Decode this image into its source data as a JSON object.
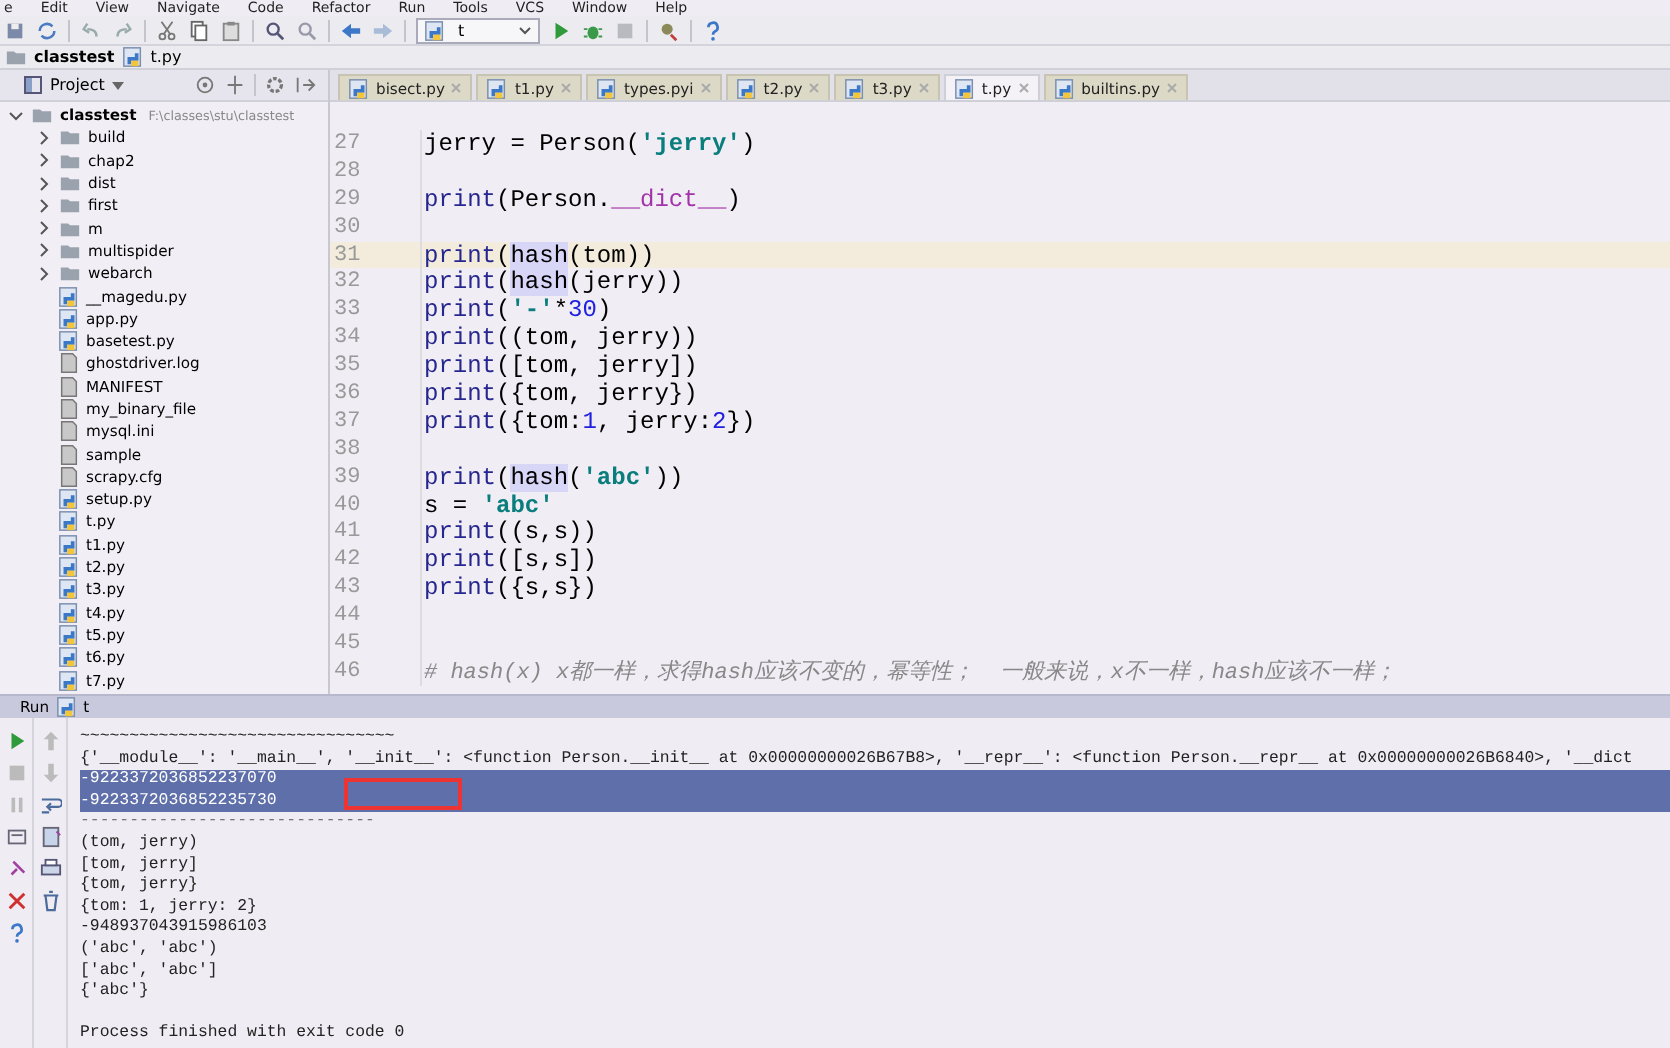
{
  "menu": [
    "e",
    "Edit",
    "View",
    "Navigate",
    "Code",
    "Refactor",
    "Run",
    "Tools",
    "VCS",
    "Window",
    "Help"
  ],
  "toolbar": {
    "run_config": "t"
  },
  "breadcrumb": [
    "classtest",
    "t.py"
  ],
  "project": {
    "title": "Project",
    "tree": [
      {
        "name": "classtest",
        "path": "F:\\classes\\stu\\classtest",
        "kind": "folder",
        "expanded": true,
        "children": [
          {
            "name": "build",
            "kind": "folder",
            "expanded": false
          },
          {
            "name": "chap2",
            "kind": "folder",
            "expanded": false
          },
          {
            "name": "dist",
            "kind": "folder",
            "expanded": false
          },
          {
            "name": "first",
            "kind": "folder",
            "expanded": false
          },
          {
            "name": "m",
            "kind": "folder",
            "expanded": false
          },
          {
            "name": "multispider",
            "kind": "folder",
            "expanded": false
          },
          {
            "name": "webarch",
            "kind": "folder",
            "expanded": false
          },
          {
            "name": "__magedu.py",
            "kind": "python"
          },
          {
            "name": "app.py",
            "kind": "python"
          },
          {
            "name": "basetest.py",
            "kind": "python"
          },
          {
            "name": "ghostdriver.log",
            "kind": "file"
          },
          {
            "name": "MANIFEST",
            "kind": "file"
          },
          {
            "name": "my_binary_file",
            "kind": "file"
          },
          {
            "name": "mysql.ini",
            "kind": "file"
          },
          {
            "name": "sample",
            "kind": "file"
          },
          {
            "name": "scrapy.cfg",
            "kind": "file"
          },
          {
            "name": "setup.py",
            "kind": "python"
          },
          {
            "name": "t.py",
            "kind": "python"
          },
          {
            "name": "t1.py",
            "kind": "python"
          },
          {
            "name": "t2.py",
            "kind": "python"
          },
          {
            "name": "t3.py",
            "kind": "python"
          },
          {
            "name": "t4.py",
            "kind": "python"
          },
          {
            "name": "t5.py",
            "kind": "python"
          },
          {
            "name": "t6.py",
            "kind": "python"
          },
          {
            "name": "t7.py",
            "kind": "python"
          }
        ]
      }
    ]
  },
  "tabs": [
    {
      "label": "bisect.py",
      "selected": false
    },
    {
      "label": "t1.py",
      "selected": false
    },
    {
      "label": "types.pyi",
      "selected": false
    },
    {
      "label": "t2.py",
      "selected": false
    },
    {
      "label": "t3.py",
      "selected": false
    },
    {
      "label": "t.py",
      "selected": true
    },
    {
      "label": "builtins.py",
      "selected": false
    }
  ],
  "editor": {
    "lines": [
      {
        "number": "27",
        "current": false,
        "tokens": [
          {
            "kind": "plain",
            "text": "jerry = Person("
          },
          {
            "kind": "string",
            "text": "'jerry'"
          },
          {
            "kind": "plain",
            "text": ")"
          }
        ]
      },
      {
        "number": "28",
        "current": false
      },
      {
        "number": "29",
        "current": false,
        "tokens": [
          {
            "kind": "builtin",
            "text": "print"
          },
          {
            "kind": "plain",
            "text": "(Person."
          },
          {
            "kind": "magic",
            "text": "__dict__"
          },
          {
            "kind": "plain",
            "text": ")"
          }
        ]
      },
      {
        "number": "30",
        "current": false
      },
      {
        "number": "31",
        "current": true,
        "tokens": [
          {
            "kind": "builtin",
            "text": "print"
          },
          {
            "kind": "plain",
            "text": "("
          },
          {
            "kind": "usage",
            "text": "hash"
          },
          {
            "kind": "plain",
            "text": "(tom))"
          }
        ]
      },
      {
        "number": "32",
        "current": false,
        "tokens": [
          {
            "kind": "builtin",
            "text": "print"
          },
          {
            "kind": "plain",
            "text": "("
          },
          {
            "kind": "usage",
            "text": "hash"
          },
          {
            "kind": "plain",
            "text": "(jerry))"
          }
        ]
      },
      {
        "number": "33",
        "current": false,
        "tokens": [
          {
            "kind": "builtin",
            "text": "print"
          },
          {
            "kind": "plain",
            "text": "("
          },
          {
            "kind": "string",
            "text": "'-'"
          },
          {
            "kind": "plain",
            "text": "*"
          },
          {
            "kind": "number",
            "text": "30"
          },
          {
            "kind": "plain",
            "text": ")"
          }
        ]
      },
      {
        "number": "34",
        "current": false,
        "tokens": [
          {
            "kind": "builtin",
            "text": "print"
          },
          {
            "kind": "plain",
            "text": "((tom, jerry))"
          }
        ]
      },
      {
        "number": "35",
        "current": false,
        "tokens": [
          {
            "kind": "builtin",
            "text": "print"
          },
          {
            "kind": "plain",
            "text": "([tom, jerry])"
          }
        ]
      },
      {
        "number": "36",
        "current": false,
        "tokens": [
          {
            "kind": "builtin",
            "text": "print"
          },
          {
            "kind": "plain",
            "text": "({tom, jerry})"
          }
        ]
      },
      {
        "number": "37",
        "current": false,
        "tokens": [
          {
            "kind": "builtin",
            "text": "print"
          },
          {
            "kind": "plain",
            "text": "({tom:"
          },
          {
            "kind": "number",
            "text": "1"
          },
          {
            "kind": "plain",
            "text": ", jerry:"
          },
          {
            "kind": "number",
            "text": "2"
          },
          {
            "kind": "plain",
            "text": "})"
          }
        ]
      },
      {
        "number": "38",
        "current": false
      },
      {
        "number": "39",
        "current": false,
        "tokens": [
          {
            "kind": "builtin",
            "text": "print"
          },
          {
            "kind": "plain",
            "text": "("
          },
          {
            "kind": "usage",
            "text": "hash"
          },
          {
            "kind": "plain",
            "text": "("
          },
          {
            "kind": "string",
            "text": "'abc'"
          },
          {
            "kind": "plain",
            "text": "))"
          }
        ]
      },
      {
        "number": "40",
        "current": false,
        "tokens": [
          {
            "kind": "plain",
            "text": "s = "
          },
          {
            "kind": "string",
            "text": "'abc'"
          }
        ]
      },
      {
        "number": "41",
        "current": false,
        "tokens": [
          {
            "kind": "builtin",
            "text": "print"
          },
          {
            "kind": "plain",
            "text": "((s,s))"
          }
        ]
      },
      {
        "number": "42",
        "current": false,
        "tokens": [
          {
            "kind": "builtin",
            "text": "print"
          },
          {
            "kind": "plain",
            "text": "([s,s])"
          }
        ]
      },
      {
        "number": "43",
        "current": false,
        "tokens": [
          {
            "kind": "builtin",
            "text": "print"
          },
          {
            "kind": "plain",
            "text": "({s,s})"
          }
        ]
      },
      {
        "number": "44",
        "current": false
      },
      {
        "number": "45",
        "current": false
      },
      {
        "number": "46",
        "current": false,
        "tokens": [
          {
            "kind": "comment",
            "text": "# hash(x) x都一样，求得hash应该不变的，幂等性；  一般来说，x不一样，hash应该不一样；"
          }
        ]
      }
    ]
  },
  "run": {
    "title": "Run",
    "config": "t",
    "output": [
      {
        "text": "~~~~~~~~~~~~~~~~~~~~~~~~~~~~~~~~",
        "selected": false
      },
      {
        "text": "{'__module__': '__main__', '__init__': <function Person.__init__ at 0x00000000026B67B8>, '__repr__': <function Person.__repr__ at 0x00000000026B6840>, '__dict",
        "selected": false
      },
      {
        "text": "-9223372036852237070",
        "selected": true
      },
      {
        "text": "-9223372036852235730",
        "selected": true
      },
      {
        "text": "------------------------------",
        "selected": false
      },
      {
        "text": "(tom, jerry)",
        "selected": false
      },
      {
        "text": "[tom, jerry]",
        "selected": false
      },
      {
        "text": "{tom, jerry}",
        "selected": false
      },
      {
        "text": "{tom: 1, jerry: 2}",
        "selected": false
      },
      {
        "text": "-948937043915986103",
        "selected": false
      },
      {
        "text": "('abc', 'abc')",
        "selected": false
      },
      {
        "text": "['abc', 'abc']",
        "selected": false
      },
      {
        "text": "{'abc'}",
        "selected": false
      },
      {
        "selected": false
      },
      {
        "text": "Process finished with exit code 0",
        "selected": false
      }
    ]
  }
}
